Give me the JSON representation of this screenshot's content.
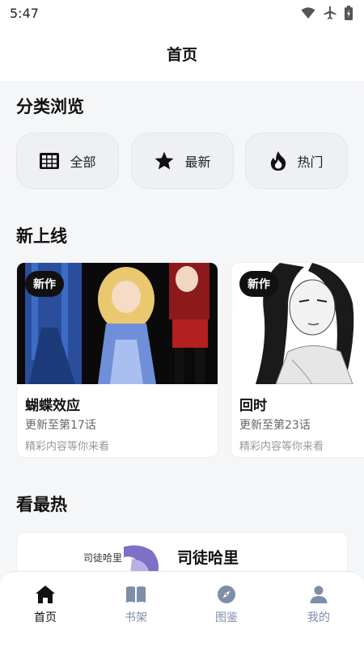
{
  "status_bar": {
    "time": "5:47",
    "icons": [
      "wifi-icon",
      "airplane-icon",
      "battery-icon"
    ]
  },
  "header": {
    "title": "首页"
  },
  "categories": {
    "title": "分类浏览",
    "items": [
      {
        "label": "全部",
        "icon": "grid-icon"
      },
      {
        "label": "最新",
        "icon": "star-icon"
      },
      {
        "label": "热门",
        "icon": "flame-icon"
      }
    ]
  },
  "new_releases": {
    "title": "新上线",
    "cards": [
      {
        "badge": "新作",
        "title": "蝴蝶效应",
        "subtitle": "更新至第17话",
        "description": "精彩内容等你来看"
      },
      {
        "badge": "新作",
        "title": "回时",
        "subtitle": "更新至第23话",
        "description": "精彩内容等你来看"
      }
    ]
  },
  "hottest": {
    "title": "看最热",
    "item": {
      "thumb_label": "司徒哈里",
      "title": "司徒哈里"
    }
  },
  "tabbar": {
    "tabs": [
      {
        "label": "首页",
        "icon": "home-icon",
        "active": true
      },
      {
        "label": "书架",
        "icon": "book-icon",
        "active": false
      },
      {
        "label": "图鉴",
        "icon": "compass-icon",
        "active": false
      },
      {
        "label": "我的",
        "icon": "user-icon",
        "active": false
      }
    ]
  },
  "colors": {
    "accent": "#111111",
    "tab_inactive": "#7d8ea8",
    "background": "#f5f6f8"
  }
}
